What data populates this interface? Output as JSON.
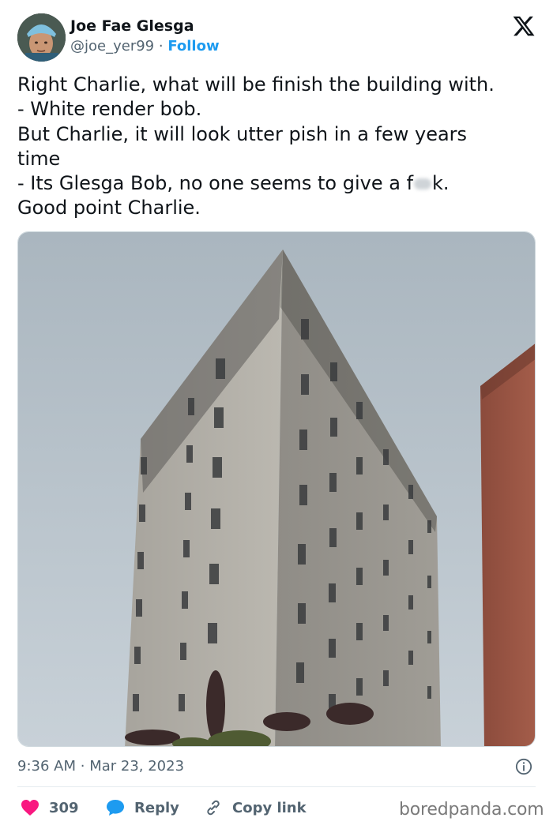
{
  "author": {
    "display_name": "Joe Fae Glesga",
    "handle": "@joe_yer99",
    "separator": "·",
    "follow_label": "Follow",
    "avatar_icon": "profile-photo-surgeon-cap"
  },
  "brand": {
    "logo_icon": "x-logo"
  },
  "tweet": {
    "lines": [
      "Right Charlie, what will be finish the building with.",
      "- White render bob.",
      "But Charlie, it will look utter pish in a few years",
      "time",
      "- Its Glesga Bob, no one seems to give a f",
      "k.",
      "Good point Charlie."
    ]
  },
  "media": {
    "description_icon": "photo-concrete-tower-block"
  },
  "meta": {
    "time": "9:36 AM",
    "separator": "·",
    "date": "Mar 23, 2023",
    "info_icon": "info-circle-icon"
  },
  "actions": {
    "like_count": "309",
    "reply_label": "Reply",
    "copy_label": "Copy link"
  },
  "watermark": "boredpanda.com",
  "colors": {
    "accent": "#1d9bf0",
    "like": "#f91880",
    "text": "#0f1419",
    "muted": "#536471"
  }
}
